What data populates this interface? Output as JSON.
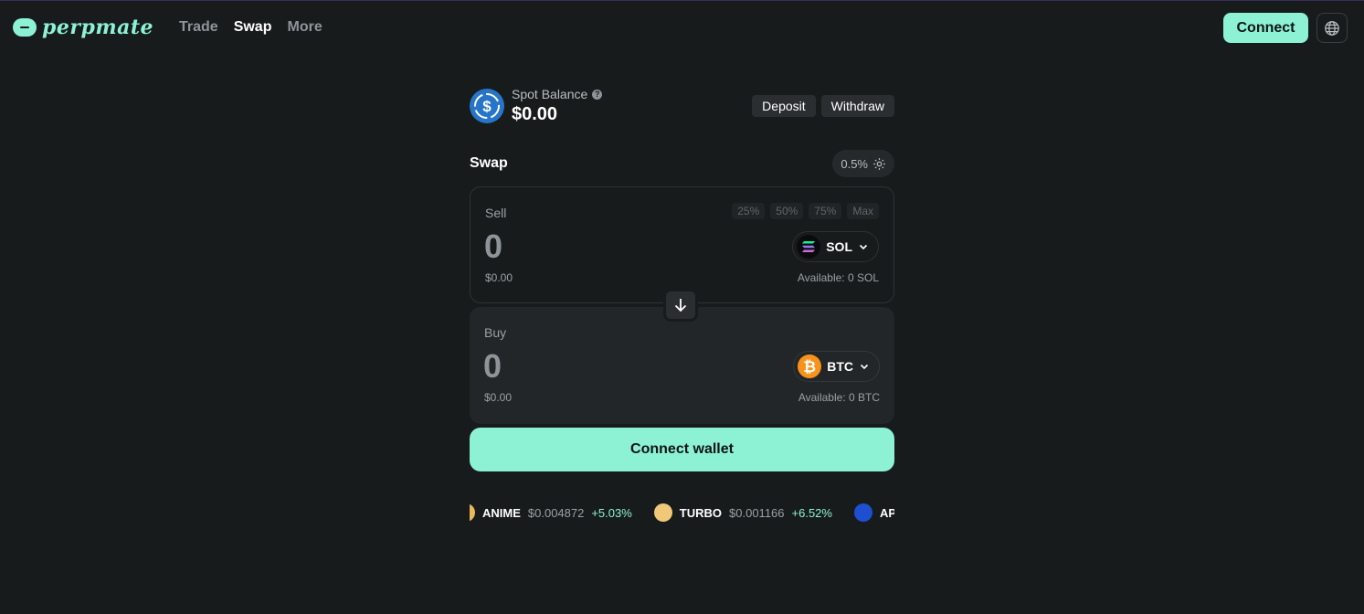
{
  "header": {
    "logo_text": "perpmate",
    "nav": [
      {
        "label": "Trade",
        "active": false
      },
      {
        "label": "Swap",
        "active": true
      },
      {
        "label": "More",
        "active": false
      }
    ],
    "connect_label": "Connect",
    "globe_icon": "globe-icon"
  },
  "balance": {
    "label": "Spot Balance",
    "value": "$0.00",
    "deposit_label": "Deposit",
    "withdraw_label": "Withdraw"
  },
  "swap": {
    "title": "Swap",
    "slippage": "0.5%",
    "sell": {
      "label": "Sell",
      "amount": "0",
      "usd": "$0.00",
      "token": "SOL",
      "available": "Available: 0 SOL",
      "percents": [
        "25%",
        "50%",
        "75%",
        "Max"
      ]
    },
    "buy": {
      "label": "Buy",
      "amount": "0",
      "usd": "$0.00",
      "token": "BTC",
      "available": "Available: 0 BTC"
    },
    "connect_wallet_label": "Connect wallet"
  },
  "ticker": [
    {
      "symbol": "ANIME",
      "price": "$0.004872",
      "change": "+5.03%"
    },
    {
      "symbol": "TURBO",
      "price": "$0.001166",
      "change": "+6.52%"
    },
    {
      "symbol": "APE",
      "price": "",
      "change": ""
    }
  ],
  "colors": {
    "accent": "#8cf2d3",
    "background": "#181b1c",
    "positive": "#8cf2d3"
  }
}
